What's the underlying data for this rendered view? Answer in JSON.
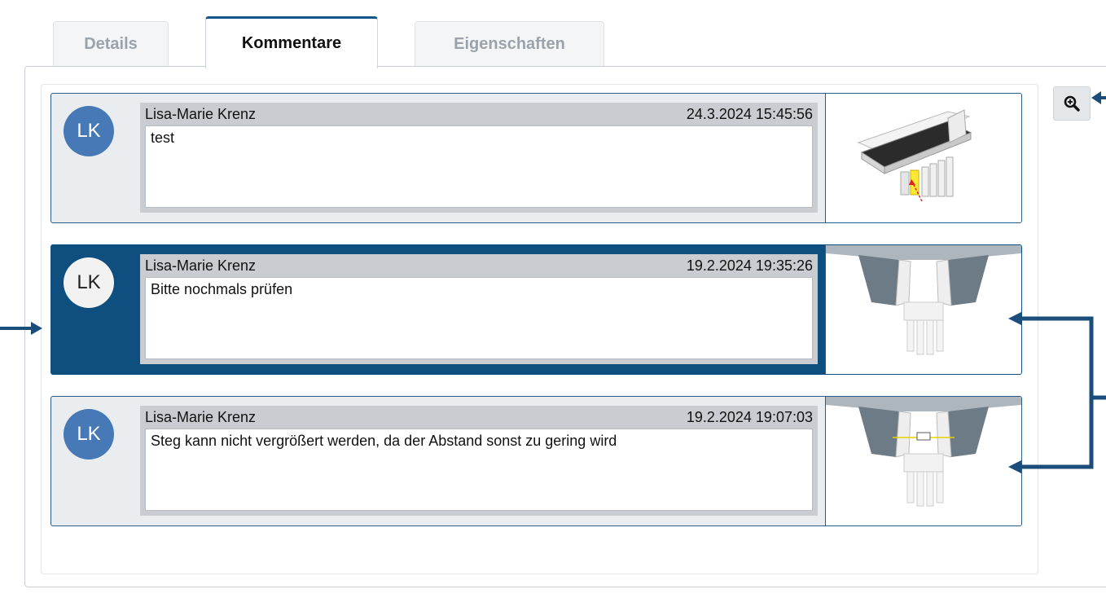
{
  "tabs": [
    {
      "label": "Details",
      "active": false
    },
    {
      "label": "Kommentare",
      "active": true
    },
    {
      "label": "Eigenschaften",
      "active": false
    }
  ],
  "toolbar": {
    "zoom_icon": "zoom-in-icon"
  },
  "comments": [
    {
      "initials": "LK",
      "author": "Lisa-Marie Krenz",
      "timestamp": "24.3.2024 15:45:56",
      "text": "test",
      "selected": false,
      "thumbnail": "bridge-overview-thumbnail"
    },
    {
      "initials": "LK",
      "author": "Lisa-Marie Krenz",
      "timestamp": "19.2.2024 19:35:26",
      "text": "Bitte nochmals prüfen",
      "selected": true,
      "thumbnail": "bridge-section-thumbnail"
    },
    {
      "initials": "LK",
      "author": "Lisa-Marie Krenz",
      "timestamp": "19.2.2024 19:07:03",
      "text": "Steg kann nicht vergrößert werden, da der Abstand sonst zu gering wird",
      "selected": false,
      "thumbnail": "bridge-section-measure-thumbnail"
    }
  ],
  "colors": {
    "accent": "#0f4f80",
    "avatar": "#4679b6",
    "selected_background": "#0f4f80",
    "annotation_arrow": "#1b4d7a"
  }
}
